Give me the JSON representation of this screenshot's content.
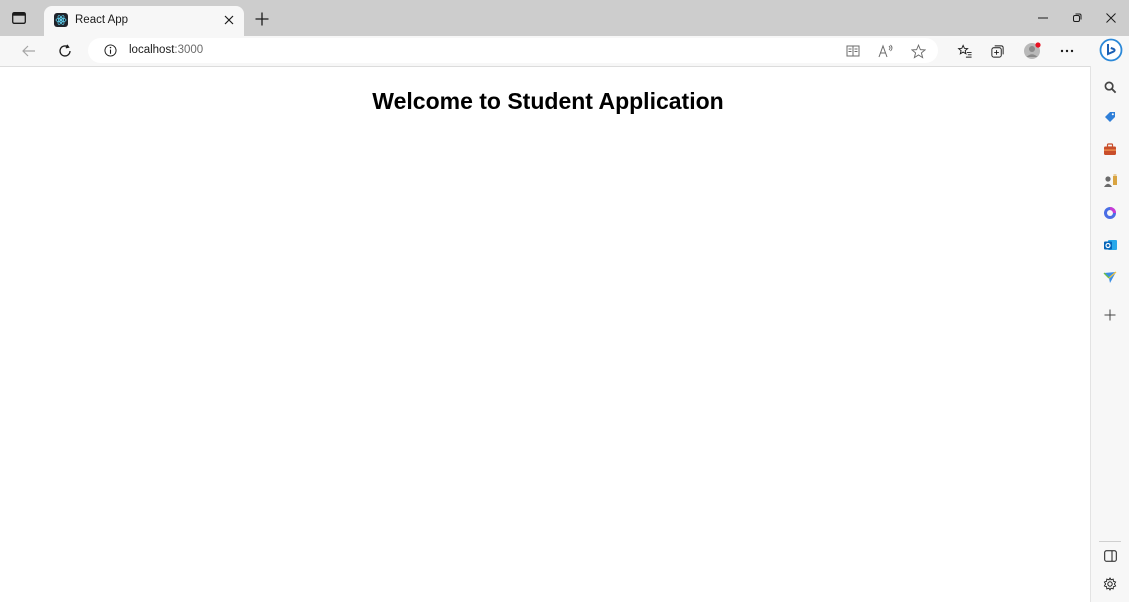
{
  "tab": {
    "title": "React App",
    "favicon": "react-icon"
  },
  "address": {
    "info_icon": "info-icon",
    "host": "localhost",
    "port": ":3000"
  },
  "toolbar_icons": [
    "back-icon",
    "refresh-icon",
    "immersive-reader-icon",
    "read-aloud-icon",
    "favorite-star-icon",
    "favorites-list-icon",
    "collections-icon",
    "profile-avatar-icon",
    "more-icon",
    "bing-chat-icon"
  ],
  "window_controls": [
    "minimize-icon",
    "restore-icon",
    "close-icon"
  ],
  "page": {
    "heading": "Welcome to Student Application"
  },
  "sidebar": {
    "items": [
      "search-icon",
      "tag-icon",
      "briefcase-icon",
      "games-icon",
      "office-icon",
      "outlook-icon",
      "send-icon",
      "add-icon"
    ],
    "bottom": [
      "hide-sidebar-icon",
      "settings-icon"
    ]
  },
  "colors": {
    "tabstrip": "#cdcdcd",
    "toolbar": "#f7f7f7",
    "accent": "#0a66c2",
    "avatar_badge": "#e81123"
  }
}
